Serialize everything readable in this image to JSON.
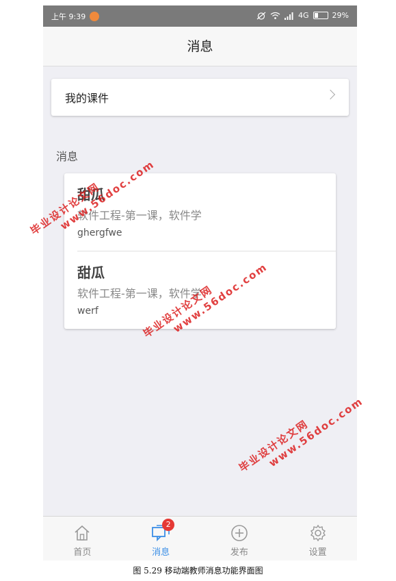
{
  "statusbar": {
    "time": "上午 9:39",
    "network": "4G",
    "battery": "29%",
    "battery_level": 0.29
  },
  "header": {
    "title": "消息"
  },
  "courses_entry": {
    "label": "我的课件"
  },
  "messages_section": {
    "label": "消息",
    "items": [
      {
        "sender": "甜瓜",
        "course": "软件工程-第一课，软件学",
        "body": "ghergfwe"
      },
      {
        "sender": "甜瓜",
        "course": "软件工程-第一课，软件学",
        "body": "werf"
      }
    ]
  },
  "tabbar": {
    "tabs": [
      {
        "label": "首页",
        "icon": "home-icon"
      },
      {
        "label": "消息",
        "icon": "message-icon",
        "badge": "2",
        "active": true
      },
      {
        "label": "发布",
        "icon": "add-circle-icon"
      },
      {
        "label": "设置",
        "icon": "gear-icon"
      }
    ]
  },
  "caption": "图 5.29  移动端教师消息功能界面图",
  "watermarks": [
    {
      "line1": "毕业设计论文网",
      "line2": "www.56doc.com"
    },
    {
      "line1": "毕业设计论文网",
      "line2": "www.56doc.com"
    },
    {
      "line1": "毕业设计论文网",
      "line2": "www.56doc.com"
    }
  ],
  "colors": {
    "accent": "#3a8ee6",
    "badge": "#e53935",
    "statusbar": "#7a7a7a",
    "watermark": "#dc1e1e"
  }
}
